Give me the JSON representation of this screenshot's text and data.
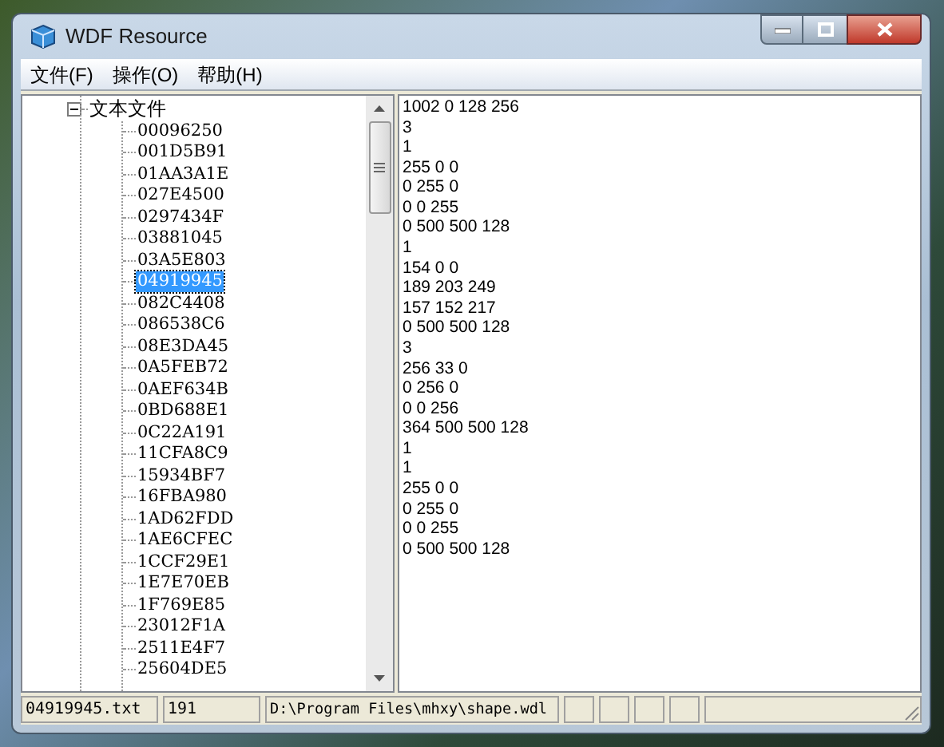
{
  "window": {
    "title": "WDF Resource"
  },
  "menu": [
    {
      "label": "文件(F)"
    },
    {
      "label": "操作(O)"
    },
    {
      "label": "帮助(H)"
    }
  ],
  "tree": {
    "label": "文本文件",
    "expanded": true,
    "children": [
      {
        "label": "00096250",
        "selected": false
      },
      {
        "label": "001D5B91",
        "selected": false
      },
      {
        "label": "01AA3A1E",
        "selected": false
      },
      {
        "label": "027E4500",
        "selected": false
      },
      {
        "label": "0297434F",
        "selected": false
      },
      {
        "label": "03881045",
        "selected": false
      },
      {
        "label": "03A5E803",
        "selected": false
      },
      {
        "label": "04919945",
        "selected": true
      },
      {
        "label": "082C4408",
        "selected": false
      },
      {
        "label": "086538C6",
        "selected": false
      },
      {
        "label": "08E3DA45",
        "selected": false
      },
      {
        "label": "0A5FEB72",
        "selected": false
      },
      {
        "label": "0AEF634B",
        "selected": false
      },
      {
        "label": "0BD688E1",
        "selected": false
      },
      {
        "label": "0C22A191",
        "selected": false
      },
      {
        "label": "11CFA8C9",
        "selected": false
      },
      {
        "label": "15934BF7",
        "selected": false
      },
      {
        "label": "16FBA980",
        "selected": false
      },
      {
        "label": "1AD62FDD",
        "selected": false
      },
      {
        "label": "1AE6CFEC",
        "selected": false
      },
      {
        "label": "1CCF29E1",
        "selected": false
      },
      {
        "label": "1E7E70EB",
        "selected": false
      },
      {
        "label": "1F769E85",
        "selected": false
      },
      {
        "label": "23012F1A",
        "selected": false
      },
      {
        "label": "2511E4F7",
        "selected": false
      },
      {
        "label": "25604DE5",
        "selected": false
      }
    ]
  },
  "content": {
    "lines": [
      "1002 0 128 256",
      "3",
      "1",
      "255 0 0",
      "0 255 0",
      "0 0 255",
      "0 500 500 128",
      "1",
      "154 0 0",
      "189 203 249",
      "157 152 217",
      "0 500 500 128",
      "3",
      "256 33 0",
      "0 256 0",
      "0 0 256",
      "364 500 500 128",
      "1",
      "1",
      "255 0 0",
      "0 255 0",
      "0 0 255",
      "0 500 500 128"
    ]
  },
  "status_bar": {
    "file": "04919945.txt",
    "size": "191",
    "path": "D:\\Program Files\\mhxy\\shape.wdl"
  }
}
